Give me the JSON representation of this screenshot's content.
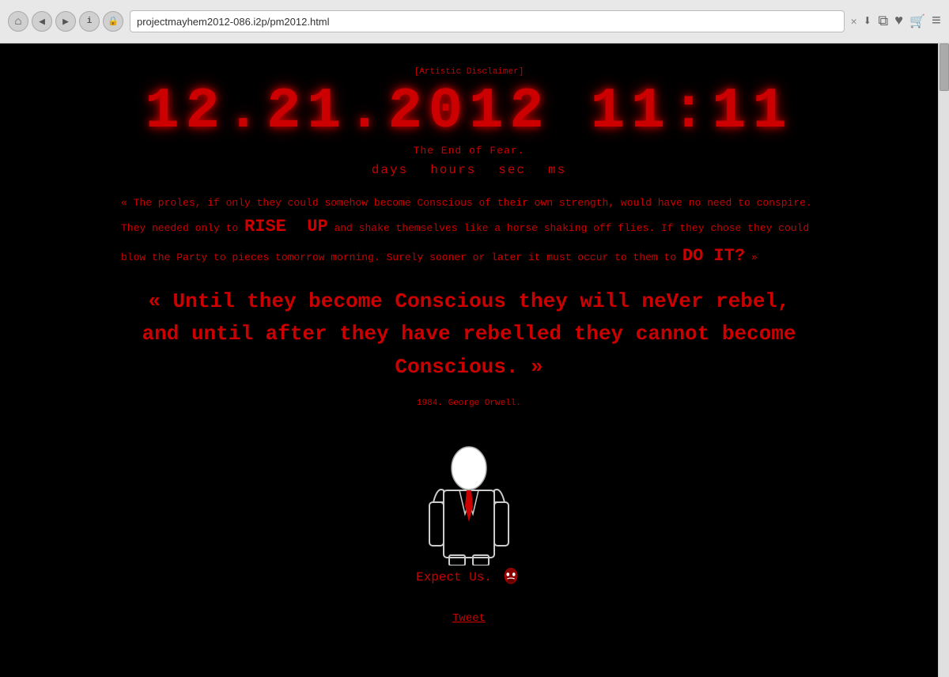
{
  "browser": {
    "url": "projectmayhem2012-086.i2p/pm2012.html",
    "back_icon": "◀",
    "forward_icon": "▶",
    "home_icon": "⌂",
    "info_icon": "i",
    "lock_icon": "🔒",
    "close_icon": "✕",
    "download_icon": "⬇",
    "window_icon": "⧉",
    "bookmark_icon": "♥",
    "cart_icon": "🛒",
    "menu_icon": "≡"
  },
  "page": {
    "disclaimer": "[Artistic Disclaimer]",
    "clock": "12.21.2012  11:11",
    "clock_subtitle": "The End of Fear.",
    "countdown_labels": [
      "days",
      "hours",
      "sec",
      "ms"
    ],
    "paragraph": "« The proles, if only they could somehow become Conscious of their own strength, would have no need to conspire. They needed only to RISE UP and shake themselves like a horse shaking off flies. If they chose they could blow the Party to pieces tomorrow morning. Surely sooner or later it must occur to them to DO IT? »",
    "main_quote_line1": "« Until they become Conscious they will neVer rebel,",
    "main_quote_line2": "and until after they have rebelled they cannot become Conscious. »",
    "author": "1984. George Orwell.",
    "expect_us": "Expect Us.",
    "tweet": "Tweet"
  }
}
